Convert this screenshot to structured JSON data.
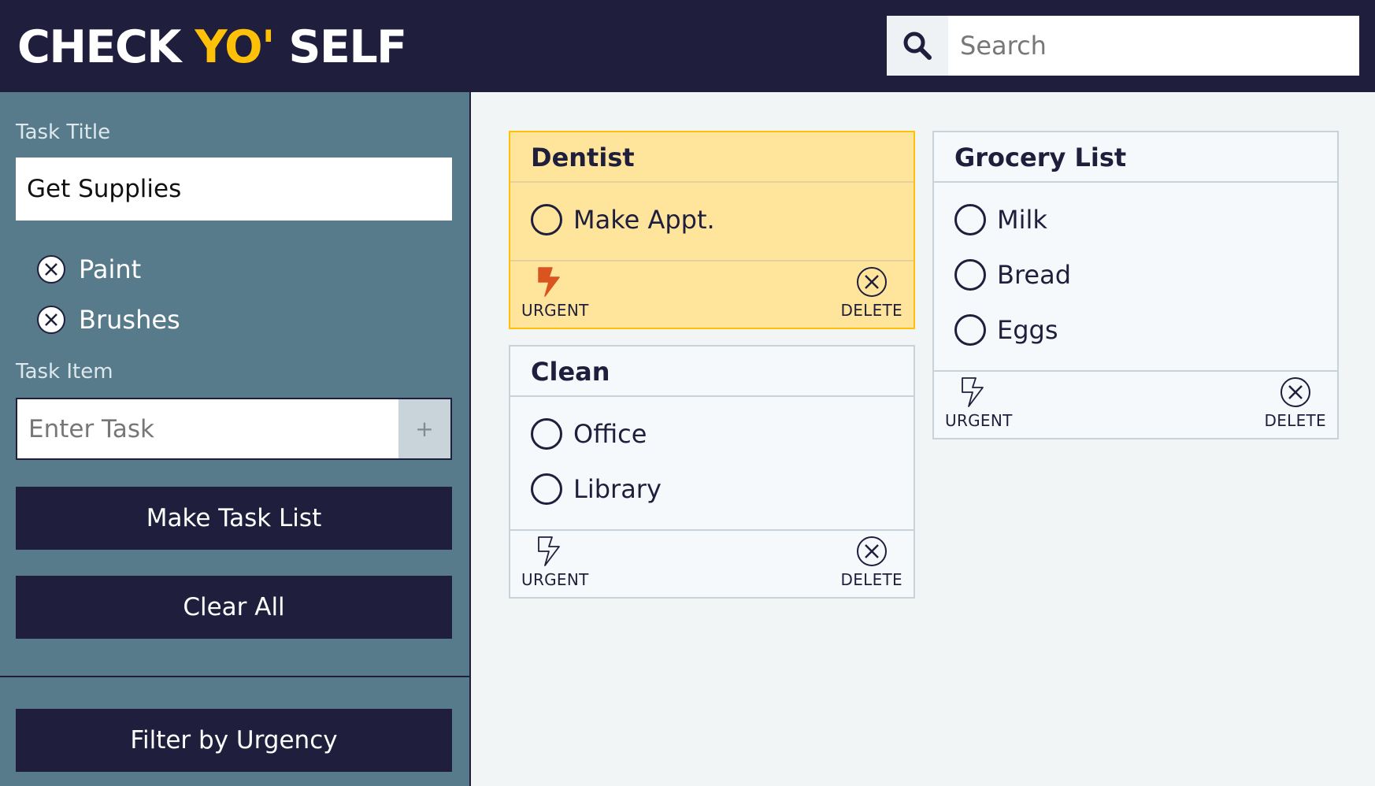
{
  "header": {
    "logo_part1": "CHECK ",
    "logo_accent": "YO'",
    "logo_part2": " SELF",
    "search_placeholder": "Search",
    "search_icon": "search-icon"
  },
  "sidebar": {
    "task_title_label": "Task Title",
    "task_title_value": "Get Supplies",
    "pending_items": [
      "Paint",
      "Brushes"
    ],
    "task_item_label": "Task Item",
    "task_item_placeholder": "Enter Task",
    "add_label": "+",
    "make_task_list_label": "Make Task List",
    "clear_all_label": "Clear All",
    "filter_label": "Filter by Urgency"
  },
  "cards": [
    {
      "title": "Dentist",
      "urgent": true,
      "items": [
        "Make Appt."
      ],
      "urgent_label": "URGENT",
      "delete_label": "DELETE"
    },
    {
      "title": "Clean",
      "urgent": false,
      "items": [
        "Office",
        "Library"
      ],
      "urgent_label": "URGENT",
      "delete_label": "DELETE"
    },
    {
      "title": "Grocery List",
      "urgent": false,
      "items": [
        "Milk",
        "Bread",
        "Eggs"
      ],
      "urgent_label": "URGENT",
      "delete_label": "DELETE"
    }
  ],
  "colors": {
    "navy": "#1f1f3d",
    "accent": "#ffc107",
    "sidebar": "#587b8b",
    "urgent_card": "#ffe59c",
    "urgent_bolt": "#d9541f"
  }
}
